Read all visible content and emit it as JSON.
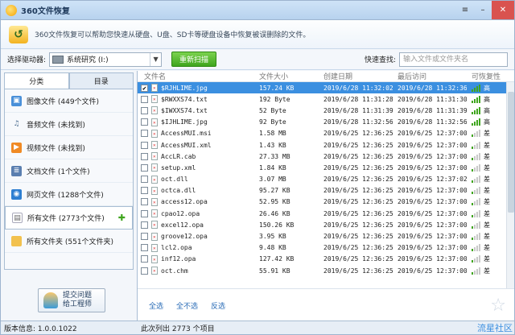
{
  "app": {
    "title": "360文件恢复"
  },
  "banner": {
    "text": "360文件恢复可以帮助您快速从硬盘、U盘、SD卡等硬盘设备中恢复被误删除的文件。"
  },
  "toolbar": {
    "drive_label": "选择驱动器:",
    "drive_value": "系统研究 (I:)",
    "rescan_label": "重新扫描",
    "quick_label": "快速查找:",
    "search_placeholder": "输入文件或文件夹名"
  },
  "sidebar": {
    "tabs": [
      "分类",
      "目录"
    ],
    "items": [
      {
        "label": "图像文件 (449个文件)",
        "icon": "image-icon",
        "color": "#4a90d9"
      },
      {
        "label": "音频文件 (未找到)",
        "icon": "music-icon",
        "color": "#6b7c8f"
      },
      {
        "label": "视频文件 (未找到)",
        "icon": "video-icon",
        "color": "#f08a24"
      },
      {
        "label": "文档文件 (1个文件)",
        "icon": "document-icon",
        "color": "#5b7fb0"
      },
      {
        "label": "网页文件 (1288个文件)",
        "icon": "web-icon",
        "color": "#2f7fd1"
      },
      {
        "label": "所有文件 (2773个文件)",
        "icon": "all-files-icon",
        "color": "#ffffff"
      },
      {
        "label": "所有文件夹 (551个文件夹)",
        "icon": "folder-icon",
        "color": "#f2c14e"
      }
    ],
    "help_line1": "提交问题",
    "help_line2": "给工程师"
  },
  "table": {
    "headers": [
      "文件名",
      "文件大小",
      "创建日期",
      "最后访问",
      "可恢复性"
    ],
    "rows": [
      {
        "name": "$RJHLIME.jpg",
        "size": "157.24 KB",
        "created": "2019/6/28 11:32:02",
        "accessed": "2019/6/28 11:32:36",
        "recover": "高",
        "checked": true,
        "selected": true
      },
      {
        "name": "$RWXXS74.txt",
        "size": "192 Byte",
        "created": "2019/6/28 11:31:28",
        "accessed": "2019/6/28 11:31:30",
        "recover": "高",
        "checked": false,
        "selected": false
      },
      {
        "name": "$IWXXS74.txt",
        "size": "52 Byte",
        "created": "2019/6/28 11:31:39",
        "accessed": "2019/6/28 11:31:39",
        "recover": "高",
        "checked": false,
        "selected": false
      },
      {
        "name": "$IJHLIME.jpg",
        "size": "92 Byte",
        "created": "2019/6/28 11:32:56",
        "accessed": "2019/6/28 11:32:56",
        "recover": "高",
        "checked": false,
        "selected": false
      },
      {
        "name": "AccessMUI.msi",
        "size": "1.58 MB",
        "created": "2019/6/25 12:36:25",
        "accessed": "2019/6/25 12:37:00",
        "recover": "差",
        "checked": false,
        "selected": false
      },
      {
        "name": "AccessMUI.xml",
        "size": "1.43 KB",
        "created": "2019/6/25 12:36:25",
        "accessed": "2019/6/25 12:37:00",
        "recover": "差",
        "checked": false,
        "selected": false
      },
      {
        "name": "AccLR.cab",
        "size": "27.33 MB",
        "created": "2019/6/25 12:36:25",
        "accessed": "2019/6/25 12:37:00",
        "recover": "差",
        "checked": false,
        "selected": false
      },
      {
        "name": "setup.xml",
        "size": "1.84 KB",
        "created": "2019/6/25 12:36:25",
        "accessed": "2019/6/25 12:37:00",
        "recover": "差",
        "checked": false,
        "selected": false
      },
      {
        "name": "oct.dll",
        "size": "3.07 MB",
        "created": "2019/6/25 12:36:25",
        "accessed": "2019/6/25 12:37:02",
        "recover": "差",
        "checked": false,
        "selected": false
      },
      {
        "name": "octca.dll",
        "size": "95.27 KB",
        "created": "2019/6/25 12:36:25",
        "accessed": "2019/6/25 12:37:00",
        "recover": "差",
        "checked": false,
        "selected": false
      },
      {
        "name": "access12.opa",
        "size": "52.95 KB",
        "created": "2019/6/25 12:36:25",
        "accessed": "2019/6/25 12:37:00",
        "recover": "差",
        "checked": false,
        "selected": false
      },
      {
        "name": "cpao12.opa",
        "size": "26.46 KB",
        "created": "2019/6/25 12:36:25",
        "accessed": "2019/6/25 12:37:00",
        "recover": "差",
        "checked": false,
        "selected": false
      },
      {
        "name": "excel12.opa",
        "size": "150.26 KB",
        "created": "2019/6/25 12:36:25",
        "accessed": "2019/6/25 12:37:00",
        "recover": "差",
        "checked": false,
        "selected": false
      },
      {
        "name": "groove12.opa",
        "size": "3.95 KB",
        "created": "2019/6/25 12:36:25",
        "accessed": "2019/6/25 12:37:00",
        "recover": "差",
        "checked": false,
        "selected": false
      },
      {
        "name": "lcl2.opa",
        "size": "9.48 KB",
        "created": "2019/6/25 12:36:25",
        "accessed": "2019/6/25 12:37:00",
        "recover": "差",
        "checked": false,
        "selected": false
      },
      {
        "name": "inf12.opa",
        "size": "127.42 KB",
        "created": "2019/6/25 12:36:25",
        "accessed": "2019/6/25 12:37:00",
        "recover": "差",
        "checked": false,
        "selected": false
      },
      {
        "name": "oct.chm",
        "size": "55.91 KB",
        "created": "2019/6/25 12:36:25",
        "accessed": "2019/6/25 12:37:00",
        "recover": "差",
        "checked": false,
        "selected": false
      }
    ],
    "select_all": "全选",
    "select_none": "全不选",
    "invert": "反选"
  },
  "status": {
    "version": "版本信息: 1.0.0.1022",
    "count": "此次列出 2773 个项目",
    "brand": "流星社区"
  }
}
